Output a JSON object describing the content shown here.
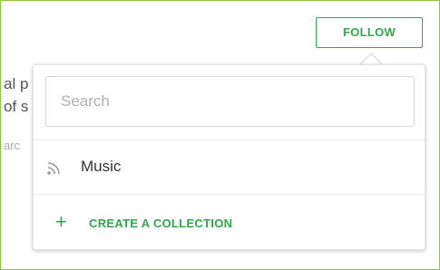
{
  "background": {
    "line1": "al p",
    "line2": "of s",
    "line3": "arc"
  },
  "follow_button": {
    "label": "FOLLOW"
  },
  "popover": {
    "search": {
      "placeholder": "Search",
      "value": ""
    },
    "collections": [
      {
        "label": "Music",
        "icon": "rss-icon"
      }
    ],
    "create_collection": {
      "icon": "plus-icon",
      "label": "CREATE A COLLECTION"
    }
  },
  "colors": {
    "accent": "#2ea84a",
    "frame": "#8cc63f"
  }
}
